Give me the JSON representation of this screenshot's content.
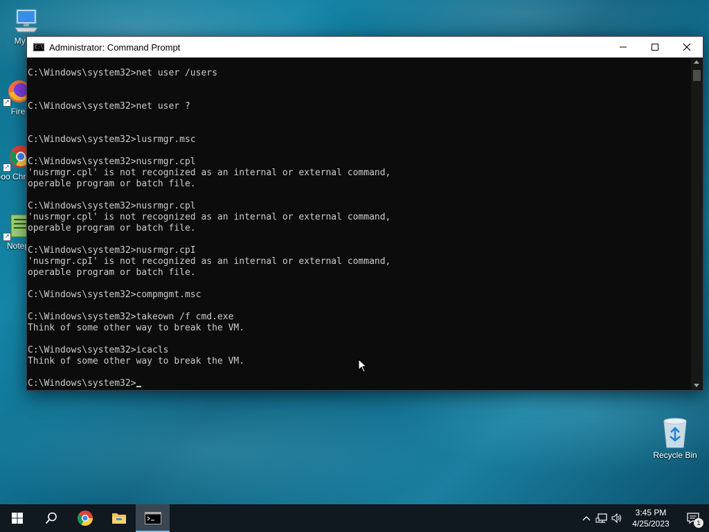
{
  "desktop": {
    "icons": [
      {
        "label": "My Co"
      },
      {
        "label": "Fire"
      },
      {
        "label": "Goo Chro"
      },
      {
        "label": "Notep"
      }
    ],
    "recycle_bin": {
      "label": "Recycle Bin"
    }
  },
  "window": {
    "title": "Administrator: Command Prompt",
    "icon_text": "C:\\.",
    "console_lines": [
      "C:\\Windows\\system32>net user /users",
      "",
      "",
      "C:\\Windows\\system32>net user ?",
      "",
      "",
      "C:\\Windows\\system32>lusrmgr.msc",
      "",
      "C:\\Windows\\system32>nusrmgr.cpl",
      "'nusrmgr.cpl' is not recognized as an internal or external command,",
      "operable program or batch file.",
      "",
      "C:\\Windows\\system32>nusrmgr.cpl",
      "'nusrmgr.cpl' is not recognized as an internal or external command,",
      "operable program or batch file.",
      "",
      "C:\\Windows\\system32>nusrmgr.cpI",
      "'nusrmgr.cpI' is not recognized as an internal or external command,",
      "operable program or batch file.",
      "",
      "C:\\Windows\\system32>compmgmt.msc",
      "",
      "C:\\Windows\\system32>takeown /f cmd.exe",
      "Think of some other way to break the VM.",
      "",
      "C:\\Windows\\system32>icacls",
      "Think of some other way to break the VM.",
      ""
    ],
    "prompt": "C:\\Windows\\system32>"
  },
  "taskbar": {
    "clock": {
      "time": "3:45 PM",
      "date": "4/25/2023"
    },
    "notification_count": "1"
  },
  "colors": {
    "console_bg": "#0c0c0c",
    "console_fg": "#cccccc",
    "taskbar_bg": "#101820",
    "accent": "#76b9ed"
  }
}
